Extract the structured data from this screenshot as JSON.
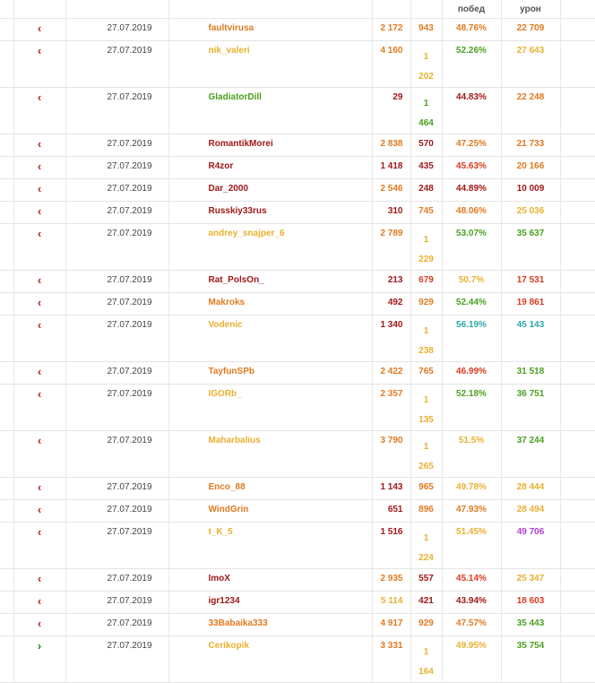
{
  "header": {
    "wins_label": "побед",
    "damage_label": "урон"
  },
  "rows": [
    {
      "dir": "red",
      "date": "27.07.2019",
      "nick": "faultvirusa",
      "nick_color": "orange",
      "battles": "2 172",
      "battles_color": "orange",
      "wins": "943",
      "wins_color": "orange",
      "pct": "48.76%",
      "pct_color": "orange",
      "dmg": "22 709",
      "dmg_color": "orange",
      "h": "r1"
    },
    {
      "dir": "red",
      "date": "27.07.2019",
      "nick": "nik_valeri",
      "nick_color": "yellow",
      "battles": "4 160",
      "battles_color": "orange",
      "wins": "1\n202",
      "wins_color": "yellow",
      "pct": "52.26%",
      "pct_color": "green",
      "dmg": "27 643",
      "dmg_color": "yellow",
      "h": "r2"
    },
    {
      "dir": "red",
      "date": "27.07.2019",
      "nick": "GladiatorDill",
      "nick_color": "green",
      "battles": "29",
      "battles_color": "darkred",
      "wins": "1\n464",
      "wins_color": "green",
      "pct": "44.83%",
      "pct_color": "darkred",
      "dmg": "22 248",
      "dmg_color": "orange",
      "h": "r2"
    },
    {
      "dir": "red",
      "date": "27.07.2019",
      "nick": "RomantikMorei",
      "nick_color": "darkred",
      "battles": "2 838",
      "battles_color": "orange",
      "wins": "570",
      "wins_color": "darkred",
      "pct": "47.25%",
      "pct_color": "orange",
      "dmg": "21 733",
      "dmg_color": "orange",
      "h": "r1"
    },
    {
      "dir": "red",
      "date": "27.07.2019",
      "nick": "R4zor",
      "nick_color": "darkred",
      "battles": "1 418",
      "battles_color": "darkred",
      "wins": "435",
      "wins_color": "darkred",
      "pct": "45.63%",
      "pct_color": "red",
      "dmg": "20 166",
      "dmg_color": "orange",
      "h": "r1"
    },
    {
      "dir": "red",
      "date": "27.07.2019",
      "nick": "Dar_2000",
      "nick_color": "darkred",
      "battles": "2 546",
      "battles_color": "orange",
      "wins": "248",
      "wins_color": "darkred",
      "pct": "44.89%",
      "pct_color": "darkred",
      "dmg": "10 009",
      "dmg_color": "darkred",
      "h": "r1"
    },
    {
      "dir": "red",
      "date": "27.07.2019",
      "nick": "Russkiy33rus",
      "nick_color": "darkred",
      "battles": "310",
      "battles_color": "darkred",
      "wins": "745",
      "wins_color": "orange",
      "pct": "48.06%",
      "pct_color": "orange",
      "dmg": "25 036",
      "dmg_color": "yellow",
      "h": "r1"
    },
    {
      "dir": "red",
      "date": "27.07.2019",
      "nick": "andrey_snajper_6",
      "nick_color": "yellow",
      "battles": "2 789",
      "battles_color": "orange",
      "wins": "1\n229",
      "wins_color": "yellow",
      "pct": "53.07%",
      "pct_color": "green",
      "dmg": "35 637",
      "dmg_color": "green",
      "h": "r2"
    },
    {
      "dir": "red",
      "date": "27.07.2019",
      "nick": "Rat_PolsOn_",
      "nick_color": "darkred",
      "battles": "213",
      "battles_color": "darkred",
      "wins": "679",
      "wins_color": "red",
      "pct": "50.7%",
      "pct_color": "yellow",
      "dmg": "17 531",
      "dmg_color": "red",
      "h": "r1"
    },
    {
      "dir": "red",
      "date": "27.07.2019",
      "nick": "Makroks",
      "nick_color": "orange",
      "battles": "492",
      "battles_color": "darkred",
      "wins": "929",
      "wins_color": "orange",
      "pct": "52.44%",
      "pct_color": "green",
      "dmg": "19 861",
      "dmg_color": "red",
      "h": "r1"
    },
    {
      "dir": "red",
      "date": "27.07.2019",
      "nick": "Vodenic",
      "nick_color": "yellow",
      "battles": "1 340",
      "battles_color": "darkred",
      "wins": "1\n238",
      "wins_color": "yellow",
      "pct": "56.19%",
      "pct_color": "teal",
      "dmg": "45 143",
      "dmg_color": "teal",
      "h": "r2"
    },
    {
      "dir": "red",
      "date": "27.07.2019",
      "nick": "TayfunSPb",
      "nick_color": "orange",
      "battles": "2 422",
      "battles_color": "orange",
      "wins": "765",
      "wins_color": "orange",
      "pct": "46.99%",
      "pct_color": "red",
      "dmg": "31 518",
      "dmg_color": "green",
      "h": "r1"
    },
    {
      "dir": "red",
      "date": "27.07.2019",
      "nick": "IGORb_",
      "nick_color": "yellow",
      "battles": "2 357",
      "battles_color": "orange",
      "wins": "1\n135",
      "wins_color": "yellow",
      "pct": "52.18%",
      "pct_color": "green",
      "dmg": "36 751",
      "dmg_color": "green",
      "h": "r2"
    },
    {
      "dir": "red",
      "date": "27.07.2019",
      "nick": "Maharbalius",
      "nick_color": "yellow",
      "battles": "3 790",
      "battles_color": "orange",
      "wins": "1\n265",
      "wins_color": "yellow",
      "pct": "51.5%",
      "pct_color": "yellow",
      "dmg": "37 244",
      "dmg_color": "green",
      "h": "r3"
    },
    {
      "dir": "red",
      "date": "27.07.2019",
      "nick": "Enco_88",
      "nick_color": "orange",
      "battles": "1 143",
      "battles_color": "darkred",
      "wins": "965",
      "wins_color": "orange",
      "pct": "49.78%",
      "pct_color": "yellow",
      "dmg": "28 444",
      "dmg_color": "yellow",
      "h": "r1"
    },
    {
      "dir": "red",
      "date": "27.07.2019",
      "nick": "WindGrin",
      "nick_color": "orange",
      "battles": "651",
      "battles_color": "darkred",
      "wins": "896",
      "wins_color": "orange",
      "pct": "47.93%",
      "pct_color": "orange",
      "dmg": "28 494",
      "dmg_color": "yellow",
      "h": "r1"
    },
    {
      "dir": "red",
      "date": "27.07.2019",
      "nick": "t_K_5",
      "nick_color": "yellow",
      "battles": "1 516",
      "battles_color": "darkred",
      "wins": "1\n224",
      "wins_color": "yellow",
      "pct": "51.45%",
      "pct_color": "yellow",
      "dmg": "49 706",
      "dmg_color": "purple",
      "h": "r2"
    },
    {
      "dir": "red",
      "date": "27.07.2019",
      "nick": "ImoX",
      "nick_color": "darkred",
      "battles": "2 935",
      "battles_color": "orange",
      "wins": "557",
      "wins_color": "darkred",
      "pct": "45.14%",
      "pct_color": "red",
      "dmg": "25 347",
      "dmg_color": "yellow",
      "h": "r1"
    },
    {
      "dir": "red",
      "date": "27.07.2019",
      "nick": "igr1234",
      "nick_color": "darkred",
      "battles": "5 114",
      "battles_color": "yellow",
      "wins": "421",
      "wins_color": "darkred",
      "pct": "43.94%",
      "pct_color": "darkred",
      "dmg": "18 603",
      "dmg_color": "red",
      "h": "r1"
    },
    {
      "dir": "red",
      "date": "27.07.2019",
      "nick": "33Babaika333",
      "nick_color": "orange",
      "battles": "4 917",
      "battles_color": "orange",
      "wins": "929",
      "wins_color": "orange",
      "pct": "47.57%",
      "pct_color": "orange",
      "dmg": "35 443",
      "dmg_color": "green",
      "h": "r1"
    },
    {
      "dir": "green",
      "date": "27.07.2019",
      "nick": "Cerikopik",
      "nick_color": "yellow",
      "battles": "3 331",
      "battles_color": "orange",
      "wins": "1\n164",
      "wins_color": "yellow",
      "pct": "49.95%",
      "pct_color": "yellow",
      "dmg": "35 754",
      "dmg_color": "green",
      "h": "r2"
    }
  ]
}
